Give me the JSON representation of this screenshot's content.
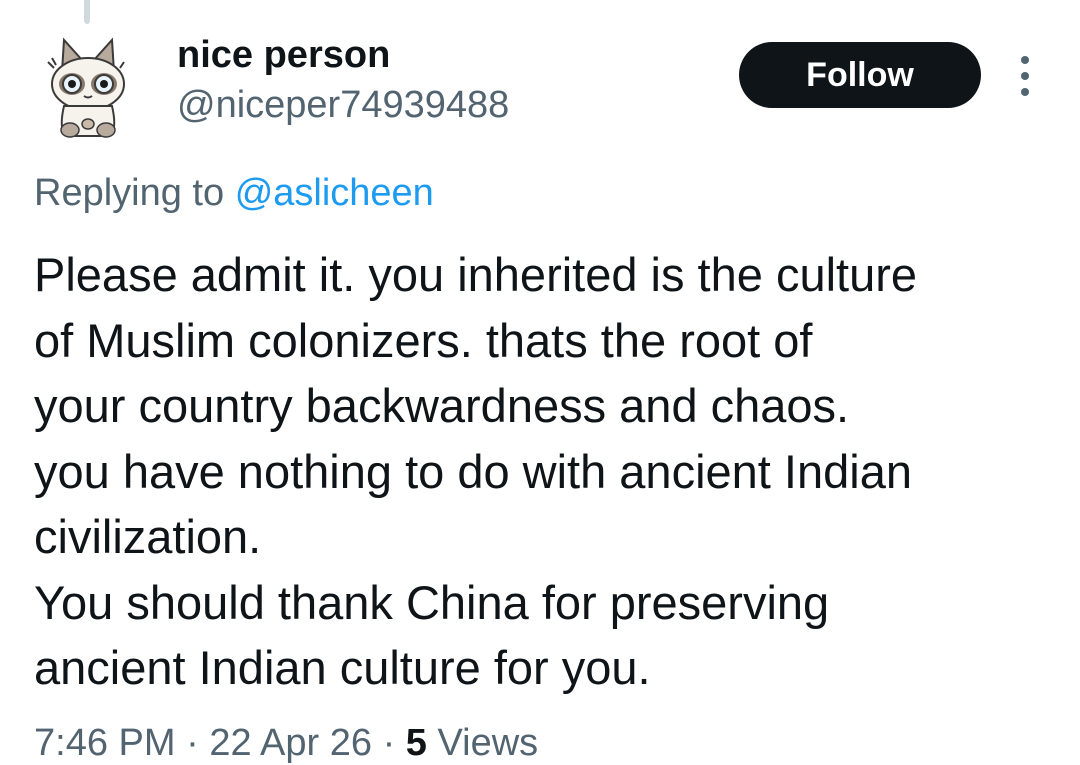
{
  "user": {
    "display_name": "nice person",
    "handle": "@niceper74939488",
    "avatar_icon": "cartoon-cat-avatar"
  },
  "actions": {
    "follow_label": "Follow",
    "more_icon": "more-vertical-icon"
  },
  "reply": {
    "prefix": "Replying to",
    "mention": "@aslicheen"
  },
  "tweet": {
    "lines": [
      "Please admit it. you inherited is the culture",
      "of Muslim colonizers. thats the root of",
      "your country backwardness and chaos.",
      "you have nothing to do with ancient Indian",
      "civilization.",
      "You should thank China for preserving",
      "ancient Indian culture for you."
    ]
  },
  "meta": {
    "time": "7:46 PM",
    "separator": "·",
    "date": "22 Apr 26",
    "views_count": "5",
    "views_label": "Views"
  },
  "colors": {
    "text_primary": "#0f1419",
    "text_secondary": "#536471",
    "link": "#1d9bf0",
    "button_bg": "#0f1419",
    "thread_line": "#cfd9de"
  }
}
